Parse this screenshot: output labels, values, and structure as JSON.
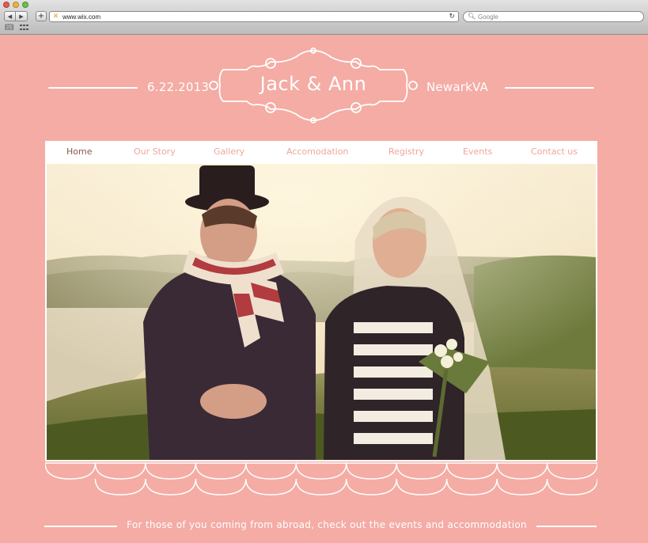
{
  "browser": {
    "url": "www.wix.com",
    "search_placeholder": "Google",
    "back_glyph": "◀",
    "forward_glyph": "▶",
    "add_glyph": "+",
    "reload_glyph": "↻"
  },
  "header": {
    "date": "6.22.2013",
    "couple": "Jack & Ann",
    "location": "NewarkVA"
  },
  "nav": {
    "items": [
      {
        "label": "Home",
        "active": true
      },
      {
        "label": "Our Story"
      },
      {
        "label": "Gallery"
      },
      {
        "label": "Accomodation"
      },
      {
        "label": "Registry"
      },
      {
        "label": "Events"
      },
      {
        "label": "Contact us"
      }
    ]
  },
  "footer": {
    "text": "For those of you coming from abroad, check out the events and accommodation"
  },
  "colors": {
    "background": "#f4aca4",
    "nav_text": "#f0a59c",
    "nav_active": "#8a5a4a",
    "white": "#ffffff"
  }
}
